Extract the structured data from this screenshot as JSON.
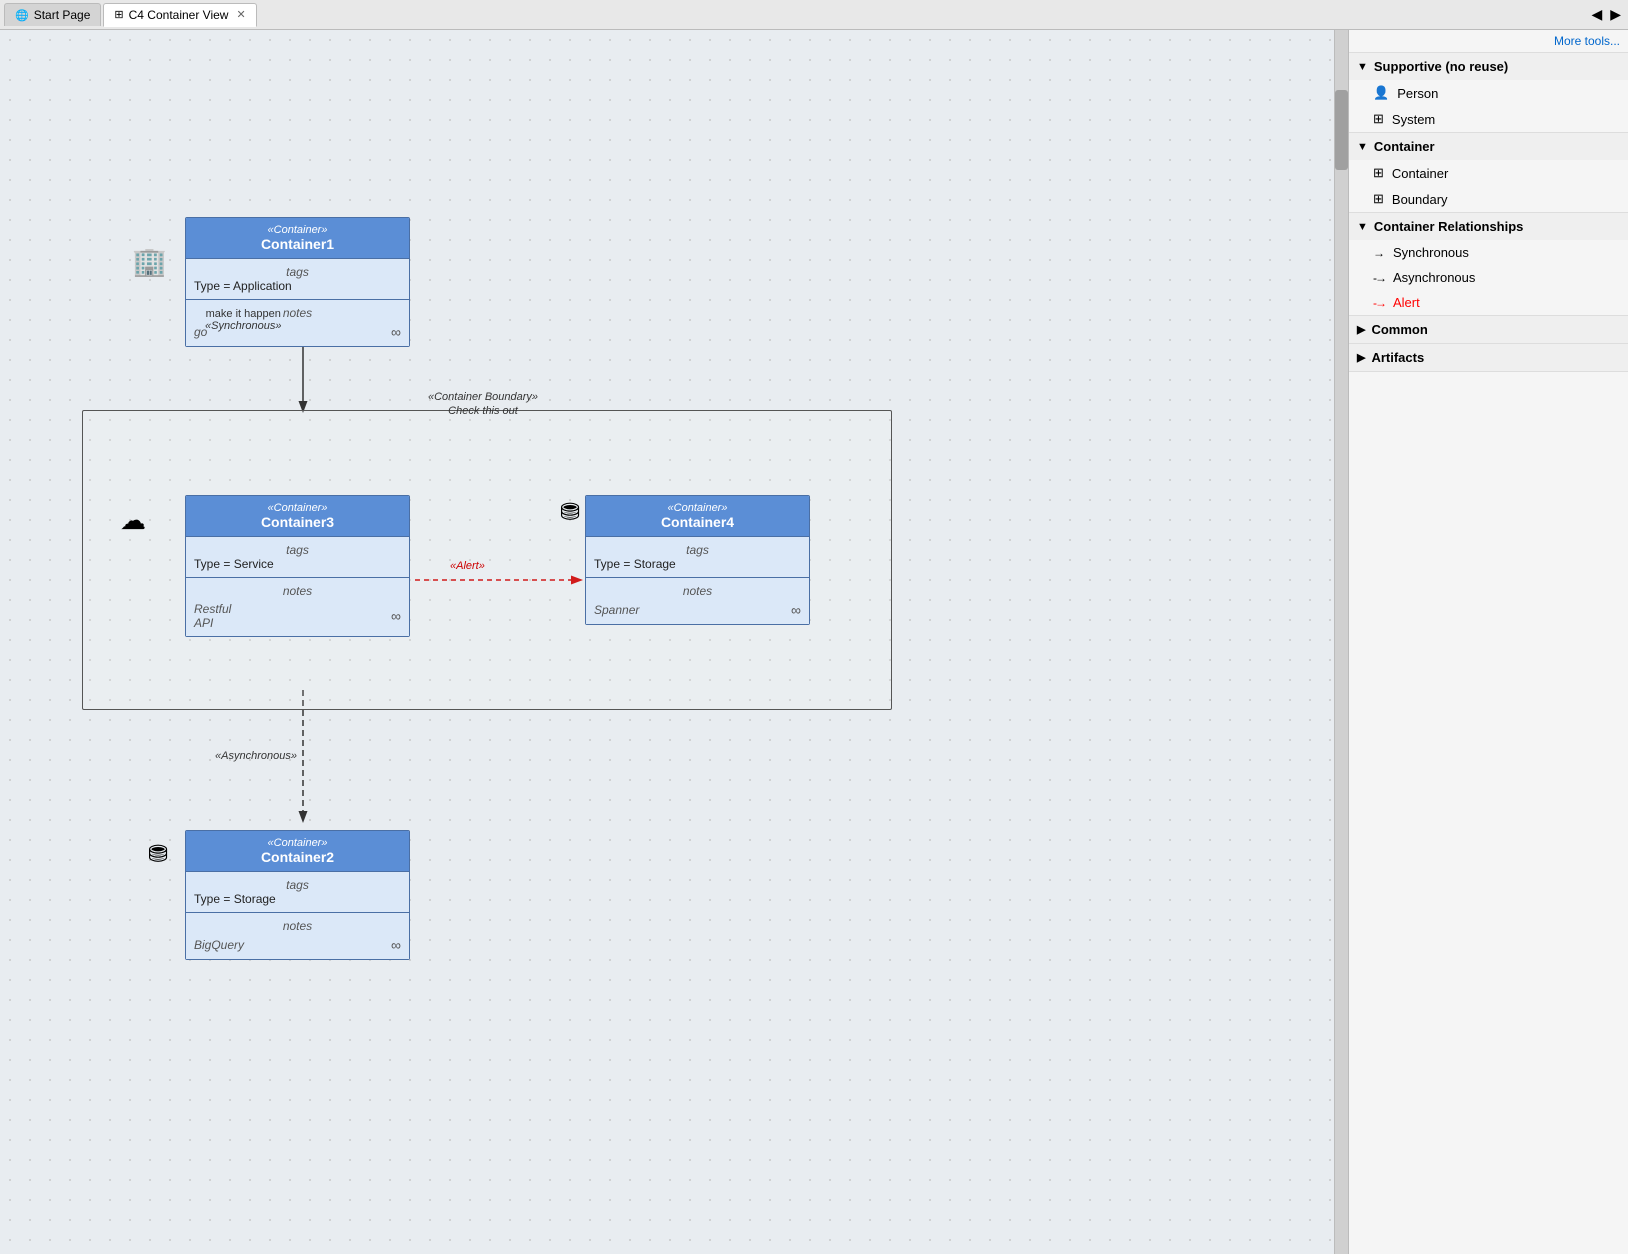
{
  "tabs": [
    {
      "id": "start",
      "icon": "🌐",
      "label": "Start Page",
      "active": false,
      "closable": false
    },
    {
      "id": "c4",
      "icon": "⊞",
      "label": "C4 Container View",
      "active": true,
      "closable": true
    }
  ],
  "more_tools": "More tools...",
  "sidebar": {
    "sections": [
      {
        "id": "supportive",
        "label": "Supportive (no reuse)",
        "expanded": true,
        "items": [
          {
            "id": "person",
            "icon": "👤",
            "label": "Person"
          },
          {
            "id": "system",
            "icon": "⊞",
            "label": "System"
          }
        ]
      },
      {
        "id": "container",
        "label": "Container",
        "expanded": true,
        "items": [
          {
            "id": "container-item",
            "icon": "⊞",
            "label": "Container"
          },
          {
            "id": "boundary",
            "icon": "⊞",
            "label": "Boundary"
          }
        ]
      },
      {
        "id": "container-relationships",
        "label": "Container Relationships",
        "expanded": true,
        "items": [
          {
            "id": "synchronous",
            "icon": "→",
            "label": "Synchronous"
          },
          {
            "id": "asynchronous",
            "icon": "⇢",
            "label": "Asynchronous"
          },
          {
            "id": "alert",
            "icon": "⇢",
            "label": "Alert",
            "color": "red"
          }
        ]
      },
      {
        "id": "common",
        "label": "Common",
        "expanded": false,
        "items": []
      },
      {
        "id": "artifacts",
        "label": "Artifacts",
        "expanded": false,
        "items": []
      }
    ]
  },
  "diagram": {
    "container1": {
      "stereotype": "«Container»",
      "name": "Container1",
      "tags_label": "tags",
      "tags_value": "Type = Application",
      "notes_label": "notes",
      "notes_value": "",
      "tech_value": "go"
    },
    "container3": {
      "stereotype": "«Container»",
      "name": "Container3",
      "tags_label": "tags",
      "tags_value": "Type = Service",
      "notes_label": "notes",
      "notes_value": "Restful\nAPI"
    },
    "container4": {
      "stereotype": "«Container»",
      "name": "Container4",
      "tags_label": "tags",
      "tags_value": "Type = Storage",
      "notes_label": "notes",
      "notes_value": "Spanner"
    },
    "container2": {
      "stereotype": "«Container»",
      "name": "Container2",
      "tags_label": "tags",
      "tags_value": "Type = Storage",
      "notes_label": "notes",
      "notes_value": "BigQuery"
    },
    "boundary_label_top": "«Container Boundary»",
    "boundary_label_bottom": "Check this out",
    "rel1": {
      "label": "make it happen",
      "type": "«Synchronous»"
    },
    "rel2": {
      "label": "«Alert»",
      "type": ""
    },
    "rel3": {
      "label": "«Asynchronous»",
      "type": ""
    }
  }
}
